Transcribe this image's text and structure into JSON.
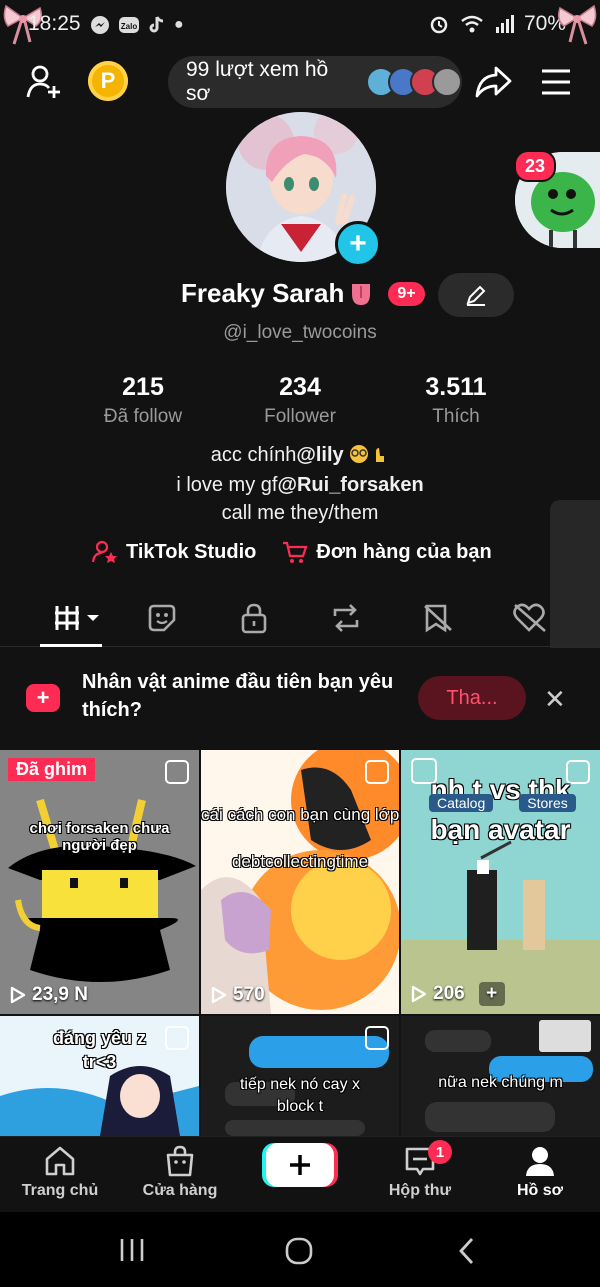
{
  "status_bar": {
    "time": "18:25",
    "battery": "70%"
  },
  "header": {
    "profile_views": "99 lượt xem hồ sơ",
    "coin_letter": "P"
  },
  "profile": {
    "name": "Freaky Sarah",
    "notif_badge": "9+",
    "side_badge": "23",
    "handle": "@i_love_twocoins",
    "stats": [
      {
        "value": "215",
        "label": "Đã follow"
      },
      {
        "value": "234",
        "label": "Follower"
      },
      {
        "value": "3.511",
        "label": "Thích"
      }
    ],
    "bio": {
      "line1_prefix": "acc chính",
      "line1_mention": "@lily",
      "line2_prefix": "i love my gf",
      "line2_mention": "@Rui_forsaken",
      "line3": "call me they/them"
    },
    "links": {
      "studio": "TikTok Studio",
      "orders": "Đơn hàng của bạn"
    }
  },
  "banner": {
    "text": "Nhân vật anime đầu tiên bạn yêu thích?",
    "button": "Tha..."
  },
  "videos": [
    {
      "pinned_label": "Đã ghim",
      "caption": "chơi forsaken chưa người đẹp",
      "views": "23,9 N"
    },
    {
      "caption": "cái cách con bạn cùng lớp nó toxic ship",
      "tag": "debtcollectingtime",
      "views": "570"
    },
    {
      "caption": "nh t vs thk bạn avatar",
      "sub_tabs": [
        "Catalog",
        "Stores"
      ],
      "views": "206"
    },
    {
      "caption": "đáng yêu z tr<3"
    },
    {
      "caption": "tiếp nek nó cay x block t"
    },
    {
      "caption": "nữa nek chúng m"
    }
  ],
  "bottom_nav": {
    "home": "Trang chủ",
    "shop": "Cửa hàng",
    "inbox": "Hộp thư",
    "inbox_badge": "1",
    "profile": "Hồ sơ"
  },
  "colors": {
    "accent": "#fe2c55",
    "cyan": "#25f4ee",
    "background": "#121212"
  }
}
